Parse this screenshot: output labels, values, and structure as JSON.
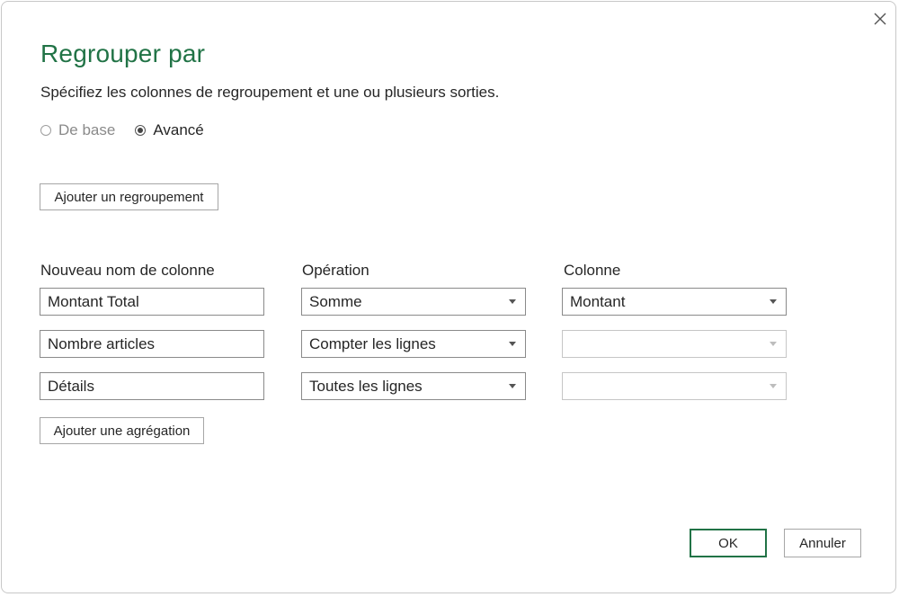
{
  "dialog": {
    "title": "Regrouper par",
    "subtitle": "Spécifiez les colonnes de regroupement et une ou plusieurs sorties.",
    "close_icon": "close-icon"
  },
  "mode": {
    "basic_label": "De base",
    "advanced_label": "Avancé",
    "selected": "Avancé"
  },
  "buttons": {
    "add_grouping": "Ajouter un regroupement",
    "add_aggregation": "Ajouter une agrégation",
    "ok": "OK",
    "cancel": "Annuler"
  },
  "columns": {
    "new_name": "Nouveau nom de colonne",
    "operation": "Opération",
    "column": "Colonne"
  },
  "rows": [
    {
      "name": "Montant Total",
      "operation": "Somme",
      "column": "Montant"
    },
    {
      "name": "Nombre articles",
      "operation": "Compter les lignes",
      "column": ""
    },
    {
      "name": "Détails",
      "operation": "Toutes les lignes",
      "column": ""
    }
  ],
  "colors": {
    "title": "#217346",
    "ok_border": "#217346"
  }
}
